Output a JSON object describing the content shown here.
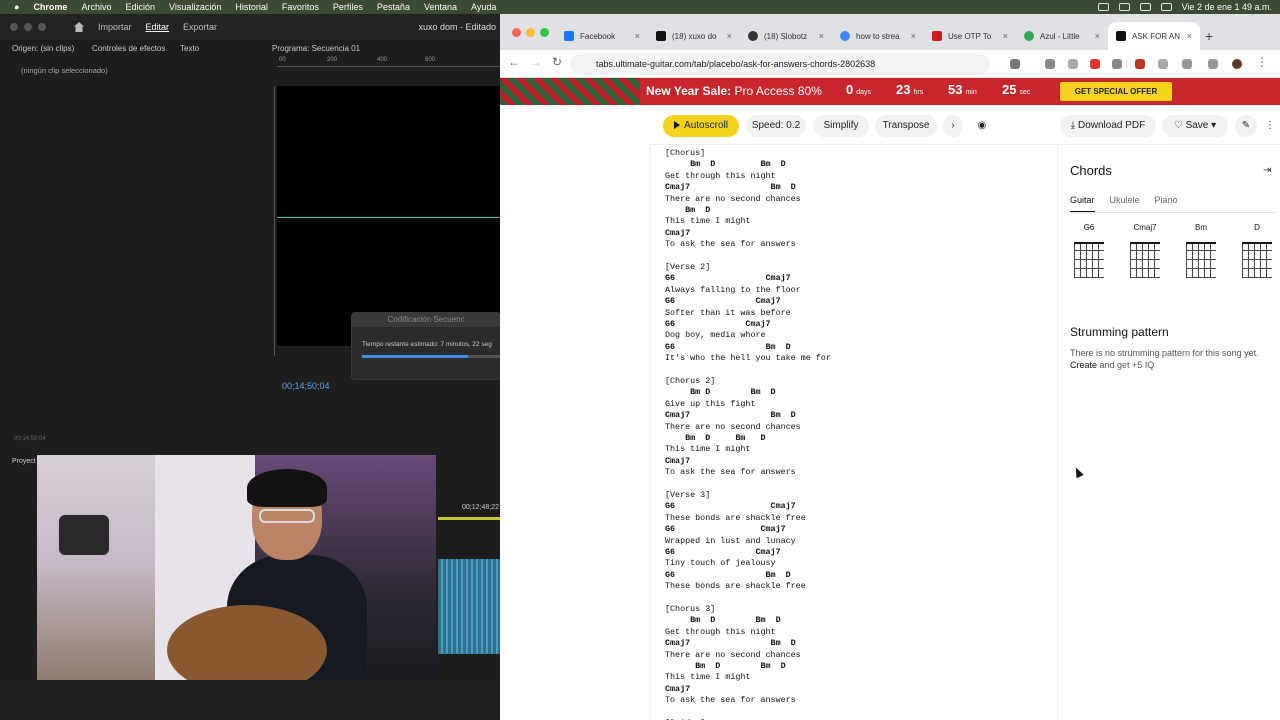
{
  "mac": {
    "app": "Chrome",
    "menus": [
      "Archivo",
      "Edición",
      "Visualización",
      "Historial",
      "Favoritos",
      "Perfiles",
      "Pestaña",
      "Ventana",
      "Ayuda"
    ],
    "clock": "Vie 2 de ene  1 49 a.m."
  },
  "premiere": {
    "tabs": [
      "Importar",
      "Editar",
      "Exportar"
    ],
    "active_tab": "Editar",
    "doc": "xuxo dom - Editado",
    "source": "Origen: (sin clips)",
    "effects": "Controles de efectos",
    "text": "Texto",
    "program": "Programa: Secuencia 01",
    "no_clip": "(ningún clip seleccionado)",
    "timecode": "00;14;50;04",
    "left_tc": "00;14;50;04",
    "tl_time": "00;12;48;22",
    "project": "Proyect",
    "ruler": [
      "00",
      "200",
      "400",
      "600"
    ],
    "dialog_title": "Codificación Secuenc",
    "dialog_text": "Tiempo restante estimado: 7 minutos, 22 seg",
    "progress": 0.76
  },
  "browser": {
    "tabs": [
      {
        "label": "Facebook",
        "color": "#1877f2"
      },
      {
        "label": "(18) xuxo do",
        "color": "#111111"
      },
      {
        "label": "(18) Slobotz",
        "color": "#333333"
      },
      {
        "label": "how to strea",
        "color": "#4285f4"
      },
      {
        "label": "Use OTP To",
        "color": "#c5221f"
      },
      {
        "label": "Azul - Little",
        "color": "#34a853"
      },
      {
        "label": "ASK FOR AN",
        "color": "#111111"
      }
    ],
    "url": "tabs.ultimate-guitar.com/tab/placebo/ask-for-answers-chords-2802638"
  },
  "promo": {
    "bold": "New Year Sale:",
    "rest": "Pro Access 80%",
    "countdown": [
      {
        "n": "0",
        "u": "days"
      },
      {
        "n": "23",
        "u": "hrs"
      },
      {
        "n": "53",
        "u": "min"
      },
      {
        "n": "25",
        "u": "sec"
      }
    ],
    "cta": "GET SPECIAL OFFER"
  },
  "toolbar": {
    "autoscroll": "Autoscroll",
    "speed": "Speed: 0.2",
    "simplify": "Simplify",
    "transpose": "Transpose",
    "download": "Download PDF",
    "save": "Save"
  },
  "tab_lines": [
    {
      "t": "[Chorus]",
      "c": false
    },
    {
      "t": "     Bm  D         Bm  D",
      "c": true
    },
    {
      "t": "Get through this night",
      "c": false
    },
    {
      "t": "Cmaj7                Bm  D",
      "c": true
    },
    {
      "t": "There are no second chances",
      "c": false
    },
    {
      "t": "    Bm  D",
      "c": true
    },
    {
      "t": "This time I might",
      "c": false
    },
    {
      "t": "Cmaj7",
      "c": true
    },
    {
      "t": "To ask the sea for answers",
      "c": false
    },
    {
      "t": "",
      "c": false
    },
    {
      "t": "[Verse 2]",
      "c": false
    },
    {
      "t": "G6                  Cmaj7",
      "c": true
    },
    {
      "t": "Always falling to the floor",
      "c": false
    },
    {
      "t": "G6                Cmaj7",
      "c": true
    },
    {
      "t": "Softer than it was before",
      "c": false
    },
    {
      "t": "G6              Cmaj7",
      "c": true
    },
    {
      "t": "Dog boy, media whore",
      "c": false
    },
    {
      "t": "G6                  Bm  D",
      "c": true
    },
    {
      "t": "It's who the hell you take me for",
      "c": false
    },
    {
      "t": "",
      "c": false
    },
    {
      "t": "[Chorus 2]",
      "c": false
    },
    {
      "t": "     Bm D        Bm  D",
      "c": true
    },
    {
      "t": "Give up this fight",
      "c": false
    },
    {
      "t": "Cmaj7                Bm  D",
      "c": true
    },
    {
      "t": "There are no second chances",
      "c": false
    },
    {
      "t": "    Bm  D     Bm   D",
      "c": true
    },
    {
      "t": "This time I might",
      "c": false
    },
    {
      "t": "Cmaj7",
      "c": true
    },
    {
      "t": "To ask the sea for answers",
      "c": false
    },
    {
      "t": "",
      "c": false
    },
    {
      "t": "[Verse 3]",
      "c": false
    },
    {
      "t": "G6                   Cmaj7",
      "c": true
    },
    {
      "t": "These bonds are shackle free",
      "c": false
    },
    {
      "t": "G6                 Cmaj7",
      "c": true
    },
    {
      "t": "Wrapped in lust and lunacy",
      "c": false
    },
    {
      "t": "G6                Cmaj7",
      "c": true
    },
    {
      "t": "Tiny touch of jealousy",
      "c": false
    },
    {
      "t": "G6                  Bm  D",
      "c": true
    },
    {
      "t": "These bonds are shackle free",
      "c": false
    },
    {
      "t": "",
      "c": false
    },
    {
      "t": "[Chorus 3]",
      "c": false
    },
    {
      "t": "     Bm  D        Bm  D",
      "c": true
    },
    {
      "t": "Get through this night",
      "c": false
    },
    {
      "t": "Cmaj7                Bm  D",
      "c": true
    },
    {
      "t": "There are no second chances",
      "c": false
    },
    {
      "t": "      Bm  D        Bm  D",
      "c": true
    },
    {
      "t": "This time I might",
      "c": false
    },
    {
      "t": "Cmaj7",
      "c": true
    },
    {
      "t": "To ask the sea for answers",
      "c": false
    },
    {
      "t": "",
      "c": false
    },
    {
      "t": "[Bridge]",
      "c": false
    }
  ],
  "sidebar": {
    "title": "Chords",
    "tabs": [
      "Guitar",
      "Ukulele",
      "Piano"
    ],
    "diagrams": [
      "G6",
      "Cmaj7",
      "Bm",
      "D"
    ],
    "strum_title": "Strumming pattern",
    "strum_desc": "There is no strumming pattern for this song yet.",
    "strum_create": "Create",
    "strum_reward": " and get +5 IQ"
  }
}
